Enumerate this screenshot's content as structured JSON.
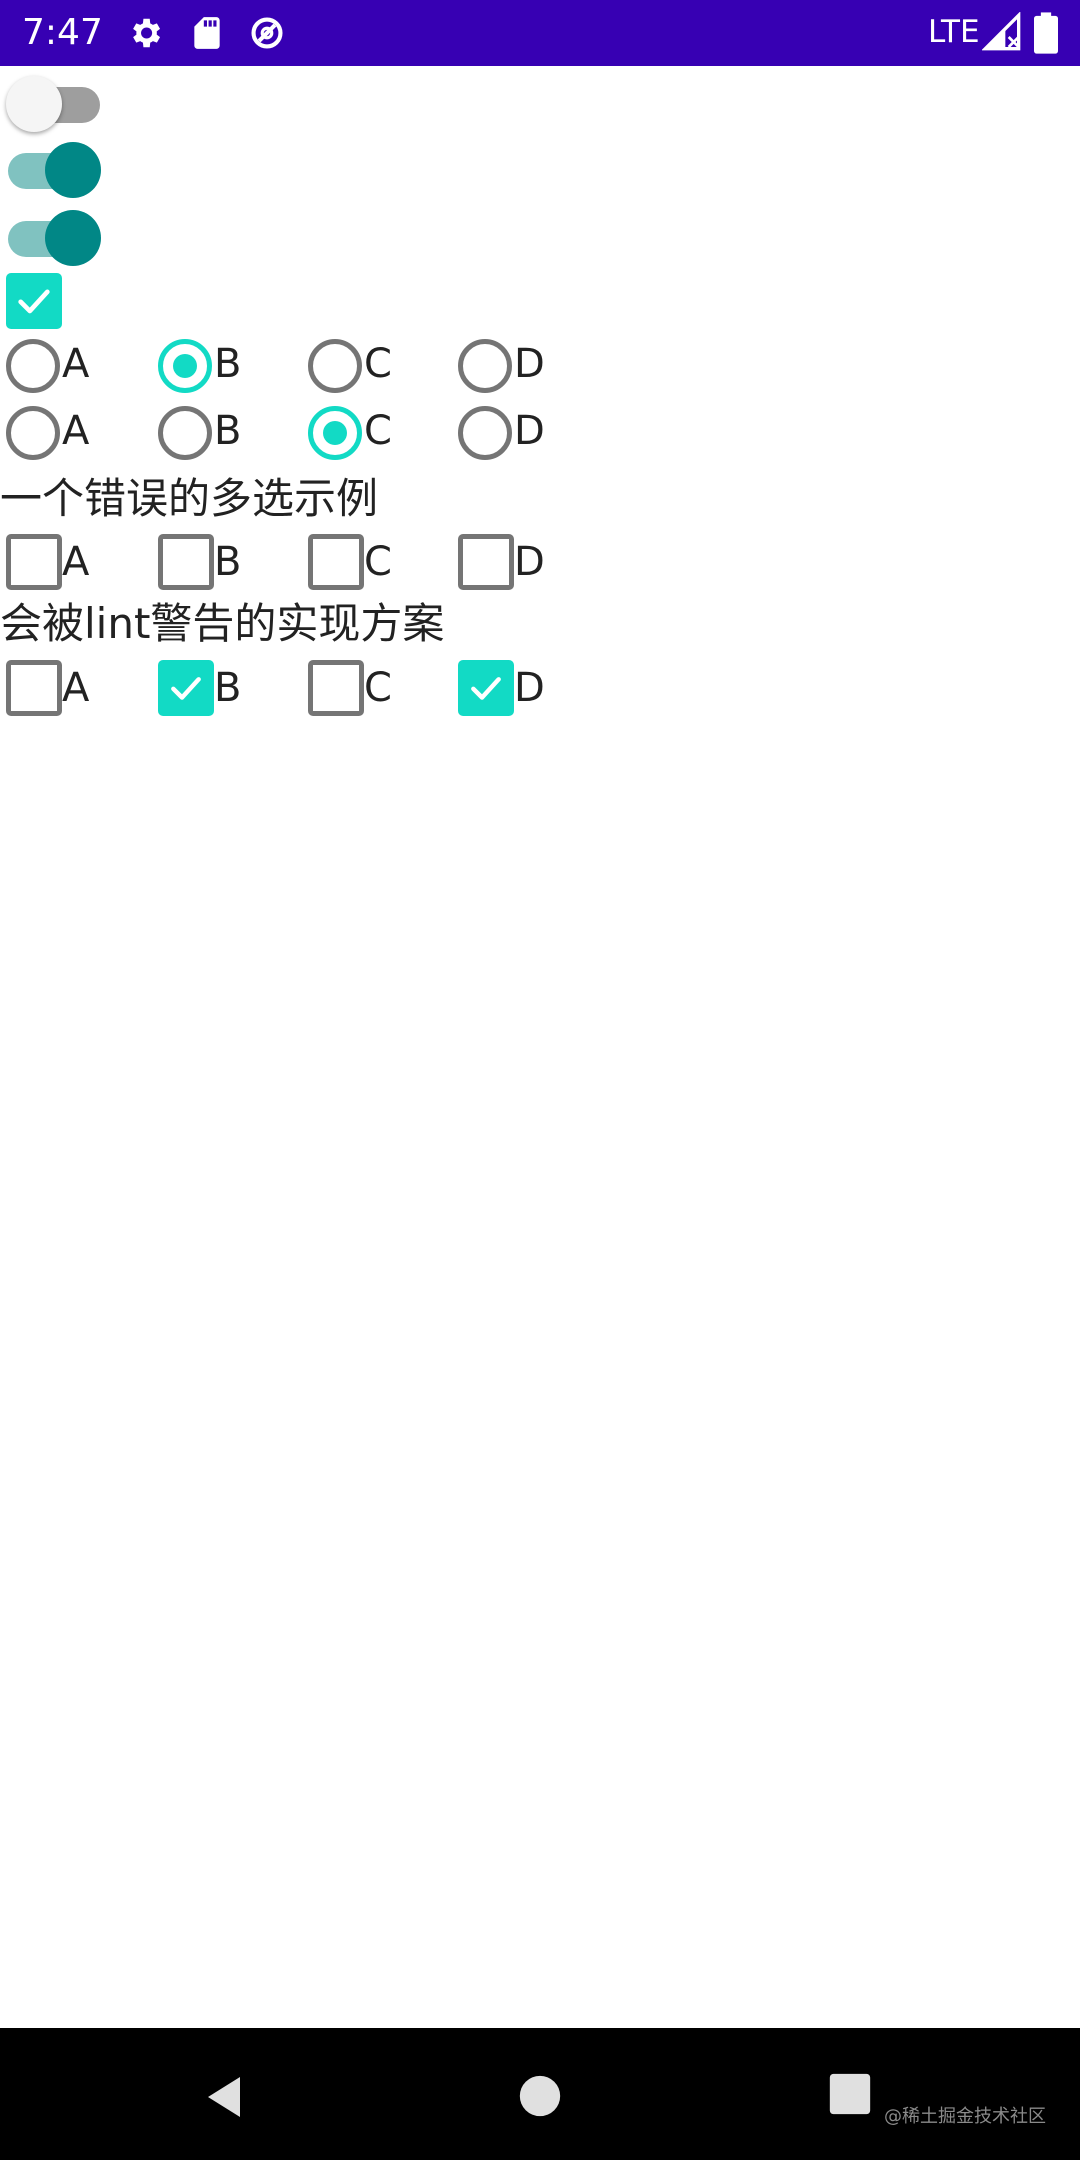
{
  "status_bar": {
    "time": "7:47",
    "network": "LTE",
    "icons": [
      "gear-icon",
      "sd-card-icon",
      "data-saver-icon",
      "signal-icon",
      "battery-icon"
    ]
  },
  "switches": [
    {
      "checked": false
    },
    {
      "checked": true
    },
    {
      "checked": true
    }
  ],
  "standalone_checkbox": {
    "checked": true
  },
  "radio_group_1": {
    "options": [
      "A",
      "B",
      "C",
      "D"
    ],
    "selected": "B"
  },
  "radio_group_2": {
    "options": [
      "A",
      "B",
      "C",
      "D"
    ],
    "selected": "C"
  },
  "section_wrong": {
    "title": "一个错误的多选示例",
    "options": [
      "A",
      "B",
      "C",
      "D"
    ],
    "checked": []
  },
  "section_lint": {
    "title": "会被lint警告的实现方案",
    "options": [
      "A",
      "B",
      "C",
      "D"
    ],
    "checked": [
      "B",
      "D"
    ]
  },
  "nav_bar": {
    "buttons": [
      "back-icon",
      "home-icon",
      "recents-icon"
    ]
  },
  "watermark": "@稀土掘金技术社区",
  "colors": {
    "status_bar": "#3700b3",
    "accent": "#12dac5",
    "switch_on": "#018786",
    "switch_track_on": "#80c2c0",
    "unchecked": "#757575"
  }
}
